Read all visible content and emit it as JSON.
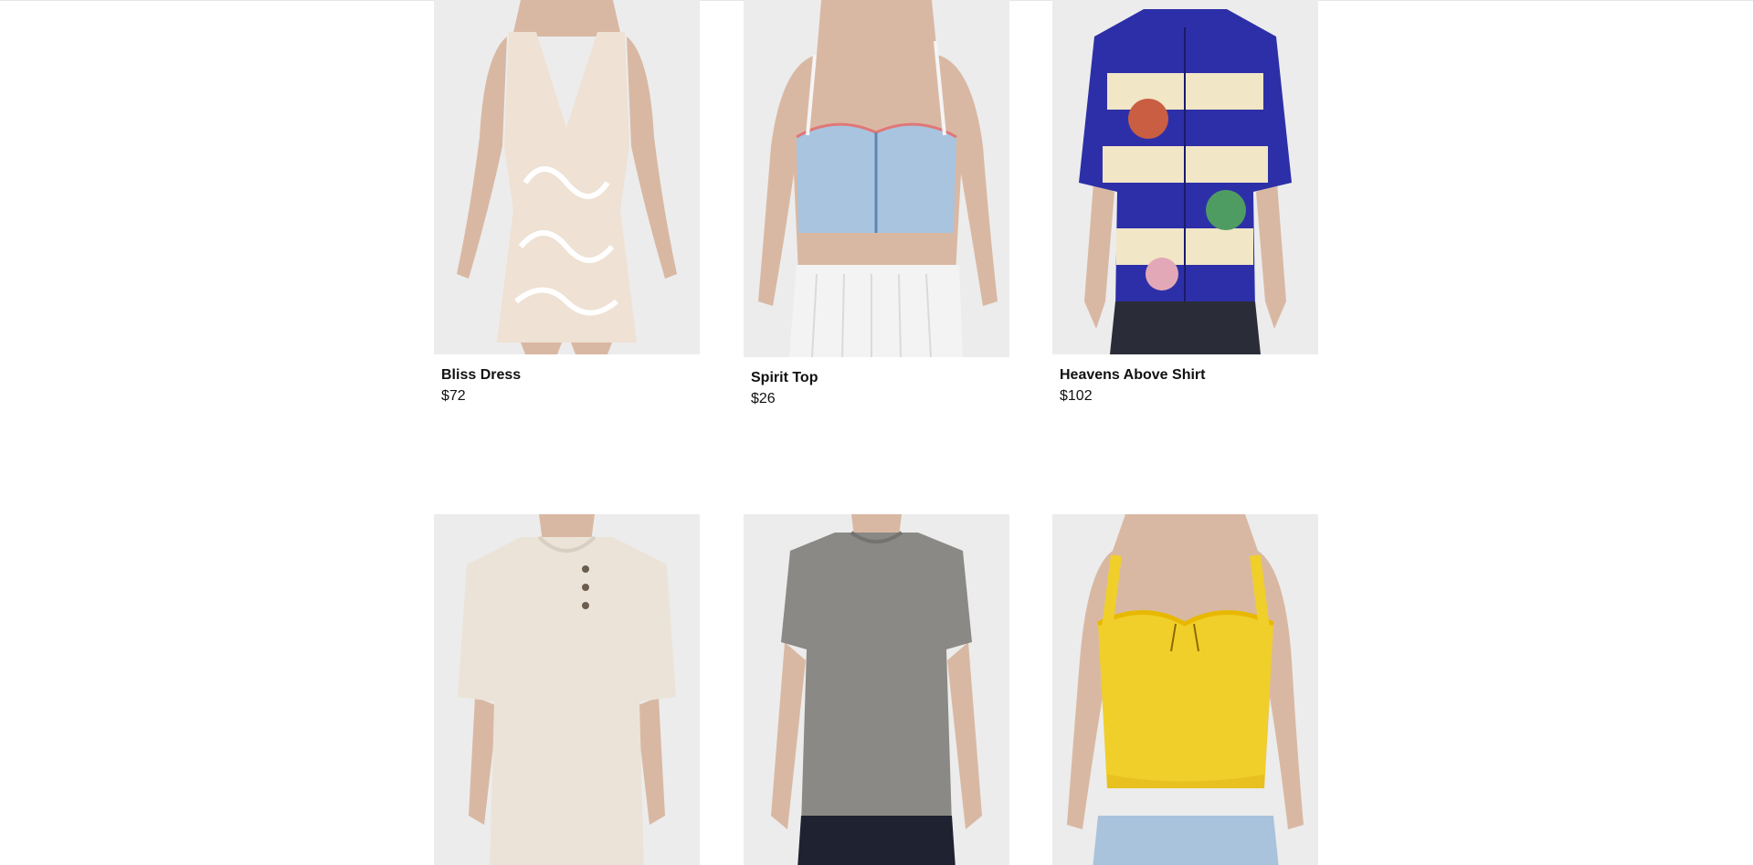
{
  "products": [
    {
      "name": "Bliss Dress",
      "price": "$72"
    },
    {
      "name": "Spirit Top",
      "price": "$26"
    },
    {
      "name": "Heavens Above Shirt",
      "price": "$102"
    },
    {
      "name": "",
      "price": ""
    },
    {
      "name": "",
      "price": ""
    },
    {
      "name": "",
      "price": ""
    }
  ],
  "colors": {
    "photo_background": "#ececec",
    "skin": "#d9b8a3",
    "dress": "#efe1d3",
    "denim": "#a8c4df",
    "skirt": "#f3f3f3",
    "shirt_blue": "#2d2fa8",
    "shirt_cream": "#f1e6c6",
    "henley": "#ebe3d8",
    "grey_tee": "#8a8985",
    "yellow_top": "#f0cf2a",
    "jeans": "#a9c3dc"
  }
}
